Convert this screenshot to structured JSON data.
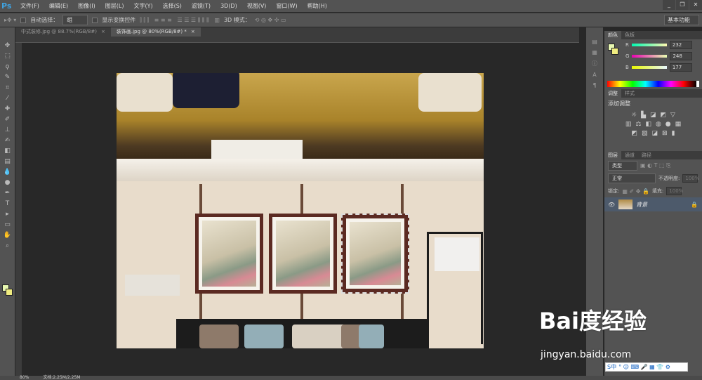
{
  "app": {
    "logo": "Ps"
  },
  "menu": [
    "文件(F)",
    "编辑(E)",
    "图像(I)",
    "图层(L)",
    "文字(Y)",
    "选择(S)",
    "滤镜(T)",
    "3D(D)",
    "视图(V)",
    "窗口(W)",
    "帮助(H)"
  ],
  "options": {
    "auto_select_label": "自动选择：",
    "auto_select_value": "组",
    "show_transform_label": "显示变换控件",
    "mode_3d_label": "3D 模式：",
    "workspace": "基本功能"
  },
  "tabs": [
    {
      "label": "中式装修.jpg @ 88.7%(RGB/8#)",
      "close": "×"
    },
    {
      "label": "装饰画.jpg @ 80%(RGB/8#) *",
      "close": "×"
    }
  ],
  "color_panel": {
    "tabs": [
      "颜色",
      "色板"
    ],
    "r_label": "R",
    "g_label": "G",
    "b_label": "B",
    "r": "232",
    "g": "248",
    "b": "177",
    "fg": "#e8f8b1"
  },
  "adjust_panel": {
    "tabs": [
      "调整",
      "样式"
    ],
    "title": "添加调整"
  },
  "layers_panel": {
    "tabs": [
      "图层",
      "通道",
      "路径"
    ],
    "filter": "类型",
    "blend": "正常",
    "opacity_label": "不透明度:",
    "opacity": "100%",
    "lock_label": "锁定:",
    "fill_label": "填充:",
    "fill": "100%",
    "layer_name": "背景"
  },
  "status": {
    "zoom": "80%",
    "doc": "文档:2.25M/2.25M"
  },
  "watermark": {
    "brand": "Bai度经验",
    "url": "jingyan.baidu.com"
  },
  "ime": {
    "label": "S中"
  }
}
